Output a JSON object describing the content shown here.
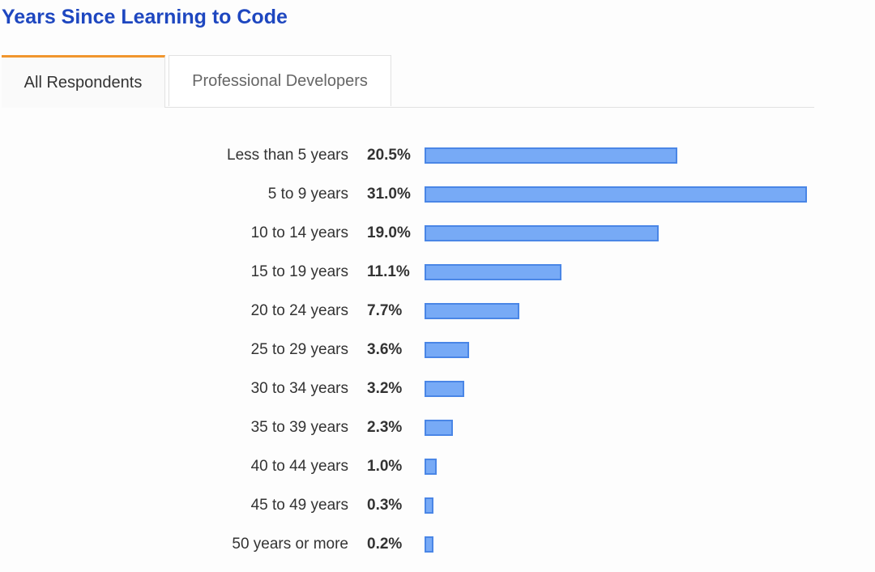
{
  "title": "Years Since Learning to Code",
  "tabs": [
    {
      "label": "All Respondents",
      "active": true
    },
    {
      "label": "Professional Developers",
      "active": false
    }
  ],
  "colors": {
    "title": "#1e47c0",
    "active_tab_accent": "#f1962d",
    "bar_fill": "#77aaf6",
    "bar_border": "#4a86e6"
  },
  "chart_data": {
    "type": "bar",
    "orientation": "horizontal",
    "title": "Years Since Learning to Code",
    "xlabel": "",
    "ylabel": "",
    "unit": "%",
    "categories": [
      "Less than 5 years",
      "5 to 9 years",
      "10 to 14 years",
      "15 to 19 years",
      "20 to 24 years",
      "25 to 29 years",
      "30 to 34 years",
      "35 to 39 years",
      "40 to 44 years",
      "45 to 49 years",
      "50 years or more"
    ],
    "values": [
      20.5,
      31.0,
      19.0,
      11.1,
      7.7,
      3.6,
      3.2,
      2.3,
      1.0,
      0.3,
      0.2
    ],
    "labels": [
      "20.5%",
      "31.0%",
      "19.0%",
      "11.1%",
      "7.7%",
      "3.6%",
      "3.2%",
      "2.3%",
      "1.0%",
      "0.3%",
      "0.2%"
    ],
    "xlim": [
      0,
      31.0
    ],
    "grid": false,
    "legend": "none"
  }
}
